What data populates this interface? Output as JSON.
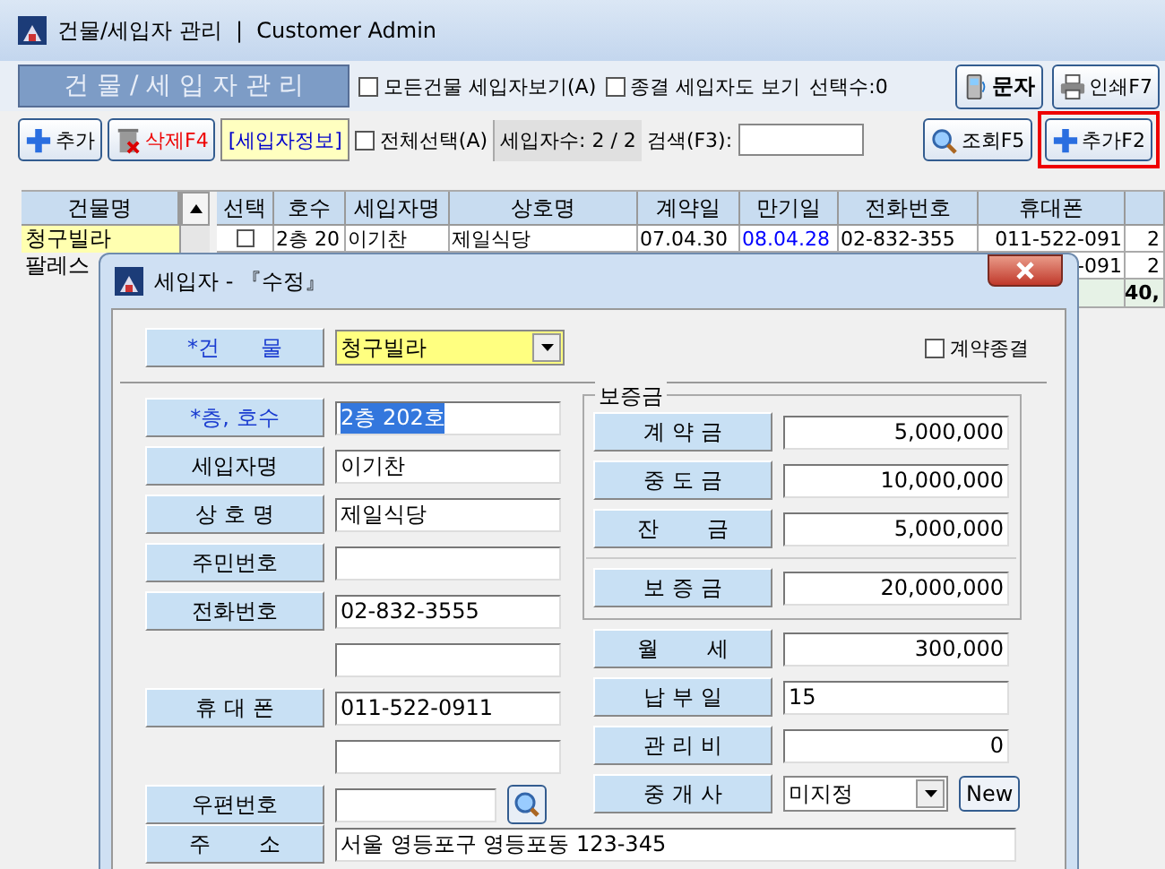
{
  "window": {
    "title": "건물/세입자 관리  |  Customer Admin"
  },
  "toolbar1": {
    "heading": "건 물 / 세 입 자 관 리",
    "checkboxes": [
      {
        "label": "모든건물 세입자보기(A)",
        "checked": false
      },
      {
        "label": "종결 세입자도 보기",
        "checked": false
      }
    ],
    "selection_count": "선택수:0",
    "buttons": [
      {
        "label": "문자",
        "kind": "sms"
      },
      {
        "label": "인쇄F7",
        "kind": "print"
      }
    ]
  },
  "toolbar2": {
    "buttons": [
      {
        "label": "추가",
        "kind": "add"
      },
      {
        "label": "삭제F4",
        "kind": "delete"
      },
      {
        "label": "[세입자정보]",
        "kind": "info"
      }
    ],
    "select_all": {
      "label": "전체선택(A)",
      "checked": false
    },
    "tenant_count": "세입자수:  2 / 2",
    "search": {
      "label": "검색(F3):"
    },
    "query_button": "조회F5",
    "add_button": {
      "label": "추가F2",
      "highlighted": true
    }
  },
  "buildings": {
    "heading": "건물명",
    "items": [
      {
        "name": "청구빌라",
        "selected": true
      },
      {
        "name": "팔레스",
        "selected": false
      }
    ]
  },
  "table": {
    "columns": [
      "선택",
      "호수",
      "세입자명",
      "상호명",
      "계약일",
      "만기일",
      "전화번호",
      "휴대폰"
    ],
    "rows": [
      {
        "checked": false,
        "expiry_due": true,
        "cells": [
          "",
          "2층 20",
          "이기찬",
          "제일식당",
          "07.04.30",
          "08.04.28",
          "02-832-355",
          "011-522-091",
          "2"
        ]
      },
      {
        "cells": [
          null,
          null,
          null,
          null,
          null,
          null,
          null,
          "-091",
          "2"
        ]
      }
    ],
    "total": "40,"
  },
  "dialog": {
    "title": "세입자 - 『수정』",
    "building": {
      "label": "*건      물",
      "value": "청구빌라"
    },
    "contract_ended": {
      "label": "계약종결",
      "checked": false
    },
    "left_fields": [
      {
        "kind": "field",
        "label": "*층, 호수",
        "required": true,
        "value": "2층 202호",
        "selected_text": true
      },
      {
        "kind": "field",
        "label": "세입자명",
        "required": false,
        "value": "이기찬",
        "selected_text": false
      },
      {
        "kind": "field",
        "label": "상 호 명",
        "required": false,
        "value": "제일식당",
        "selected_text": false
      },
      {
        "kind": "field",
        "label": "주민번호",
        "required": false
      },
      {
        "kind": "field",
        "label": "전화번호",
        "required": false,
        "value": "02-832-3555",
        "selected_text": false
      },
      {
        "kind": "blank"
      },
      {
        "kind": "field",
        "label": "휴 대 폰",
        "required": false,
        "value": "011-522-0911",
        "selected_text": false
      },
      {
        "kind": "blank"
      },
      {
        "kind": "zip",
        "label": "우편번호",
        "required": false
      }
    ],
    "deposit": {
      "legend": "보증금",
      "fields": [
        {
          "label": "계 약 금",
          "value": "5,000,000"
        },
        {
          "label": "중 도 금",
          "value": "10,000,000"
        },
        {
          "label": "잔       금",
          "value": "5,000,000"
        }
      ],
      "total": {
        "label": "보 증 금",
        "value": "20,000,000"
      }
    },
    "right_fields": [
      {
        "kind": "amount",
        "label": "월       세",
        "value": "300,000"
      },
      {
        "kind": "text",
        "label": "납 부 일",
        "value": "15"
      },
      {
        "kind": "amount",
        "label": "관 리 비",
        "value": "0"
      },
      {
        "kind": "select",
        "label": "중 개 사",
        "value": "미지정",
        "button": "New"
      }
    ],
    "address": {
      "label": "주       소",
      "value": "서울 영등포구 영등포동 123-345"
    }
  }
}
